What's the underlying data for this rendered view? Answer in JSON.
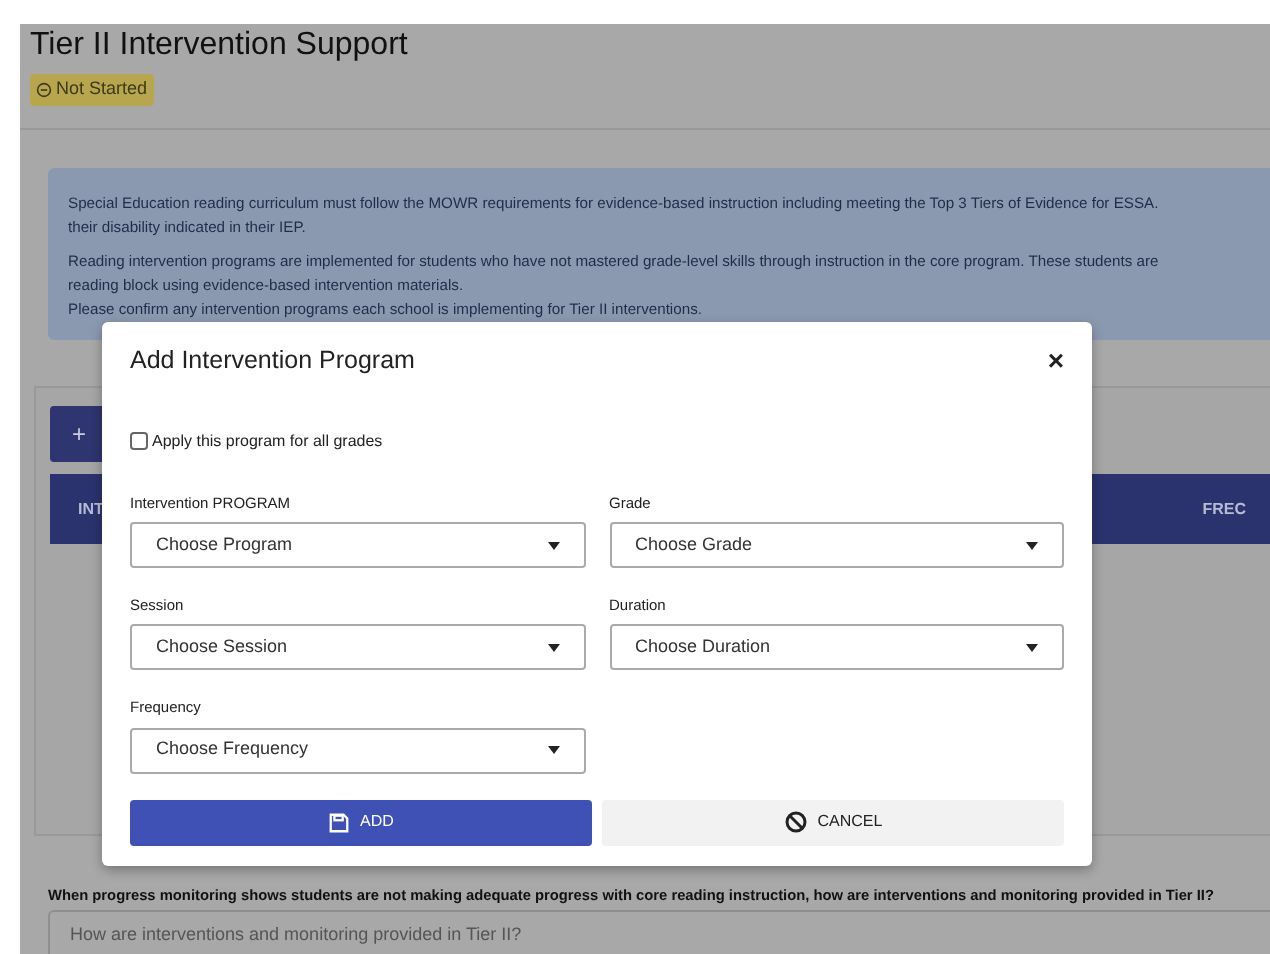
{
  "section": {
    "title": "Tier II Intervention Support",
    "status": {
      "label": "Not Started",
      "kind": "not_started"
    }
  },
  "info_paragraphs": [
    [
      "Special Education reading curriculum must follow the MOWR requirements for evidence-based instruction including meeting the Top 3 Tiers of Evidence for ESSA.",
      "their disability indicated in their IEP."
    ],
    [
      "Reading intervention programs are implemented for students who have not mastered grade-level skills through instruction in the core program. These students are",
      "reading block using evidence-based intervention materials.",
      "Please confirm any intervention programs each school is implementing for Tier II interventions."
    ]
  ],
  "background_card": {
    "add_button": "+",
    "table_headers": [
      "INT",
      "FREC"
    ]
  },
  "question": {
    "label": "When progress monitoring shows students are not making adequate progress with core reading instruction, how are interventions and monitoring provided in Tier II?",
    "placeholder": "How are interventions and monitoring provided in Tier II?"
  },
  "modal": {
    "title": "Add Intervention Program",
    "close": "×",
    "apply_all": {
      "label": "Apply this program for all grades",
      "checked": false
    },
    "fields": [
      {
        "label": "Intervention PROGRAM",
        "placeholder": "Choose Program"
      },
      {
        "label": "Grade",
        "placeholder": "Choose Grade"
      },
      {
        "label": "Session",
        "placeholder": "Choose Session"
      },
      {
        "label": "Duration",
        "placeholder": "Choose Duration"
      },
      {
        "label": "Frequency",
        "placeholder": "Choose Frequency"
      }
    ],
    "buttons": [
      {
        "label": "ADD",
        "kind": "primary"
      },
      {
        "label": "CANCEL",
        "kind": "secondary"
      }
    ]
  }
}
